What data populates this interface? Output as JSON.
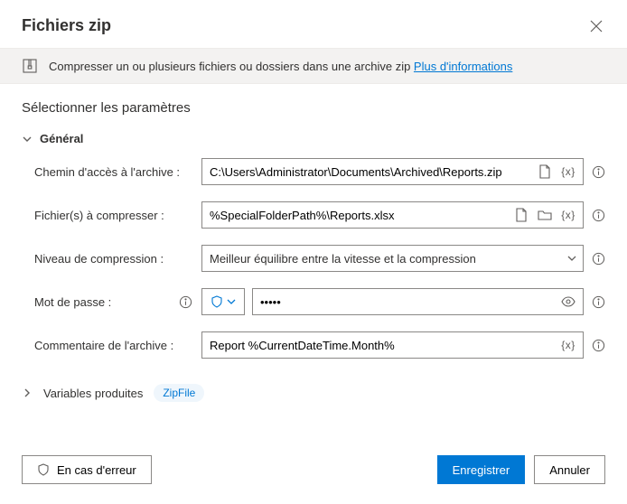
{
  "title": "Fichiers zip",
  "info": {
    "text": "Compresser un ou plusieurs fichiers ou dossiers dans une archive zip ",
    "link": "Plus d'informations"
  },
  "paramsHeading": "Sélectionner les paramètres",
  "groupGeneral": "Général",
  "fields": {
    "archivePath": {
      "label": "Chemin d'accès à l'archive :",
      "value": "C:\\Users\\Administrator\\Documents\\Archived\\Reports.zip"
    },
    "filesToZip": {
      "label": "Fichier(s) à compresser :",
      "value": "%SpecialFolderPath%\\Reports.xlsx"
    },
    "compression": {
      "label": "Niveau de compression :",
      "value": "Meilleur équilibre entre la vitesse et la compression"
    },
    "password": {
      "label": "Mot de passe :",
      "value": "•••••"
    },
    "comment": {
      "label": "Commentaire de l'archive :",
      "value": "Report %CurrentDateTime.Month%"
    }
  },
  "varsProduced": {
    "label": "Variables produites",
    "chip": "ZipFile"
  },
  "footer": {
    "onError": "En cas d'erreur",
    "save": "Enregistrer",
    "cancel": "Annuler"
  }
}
